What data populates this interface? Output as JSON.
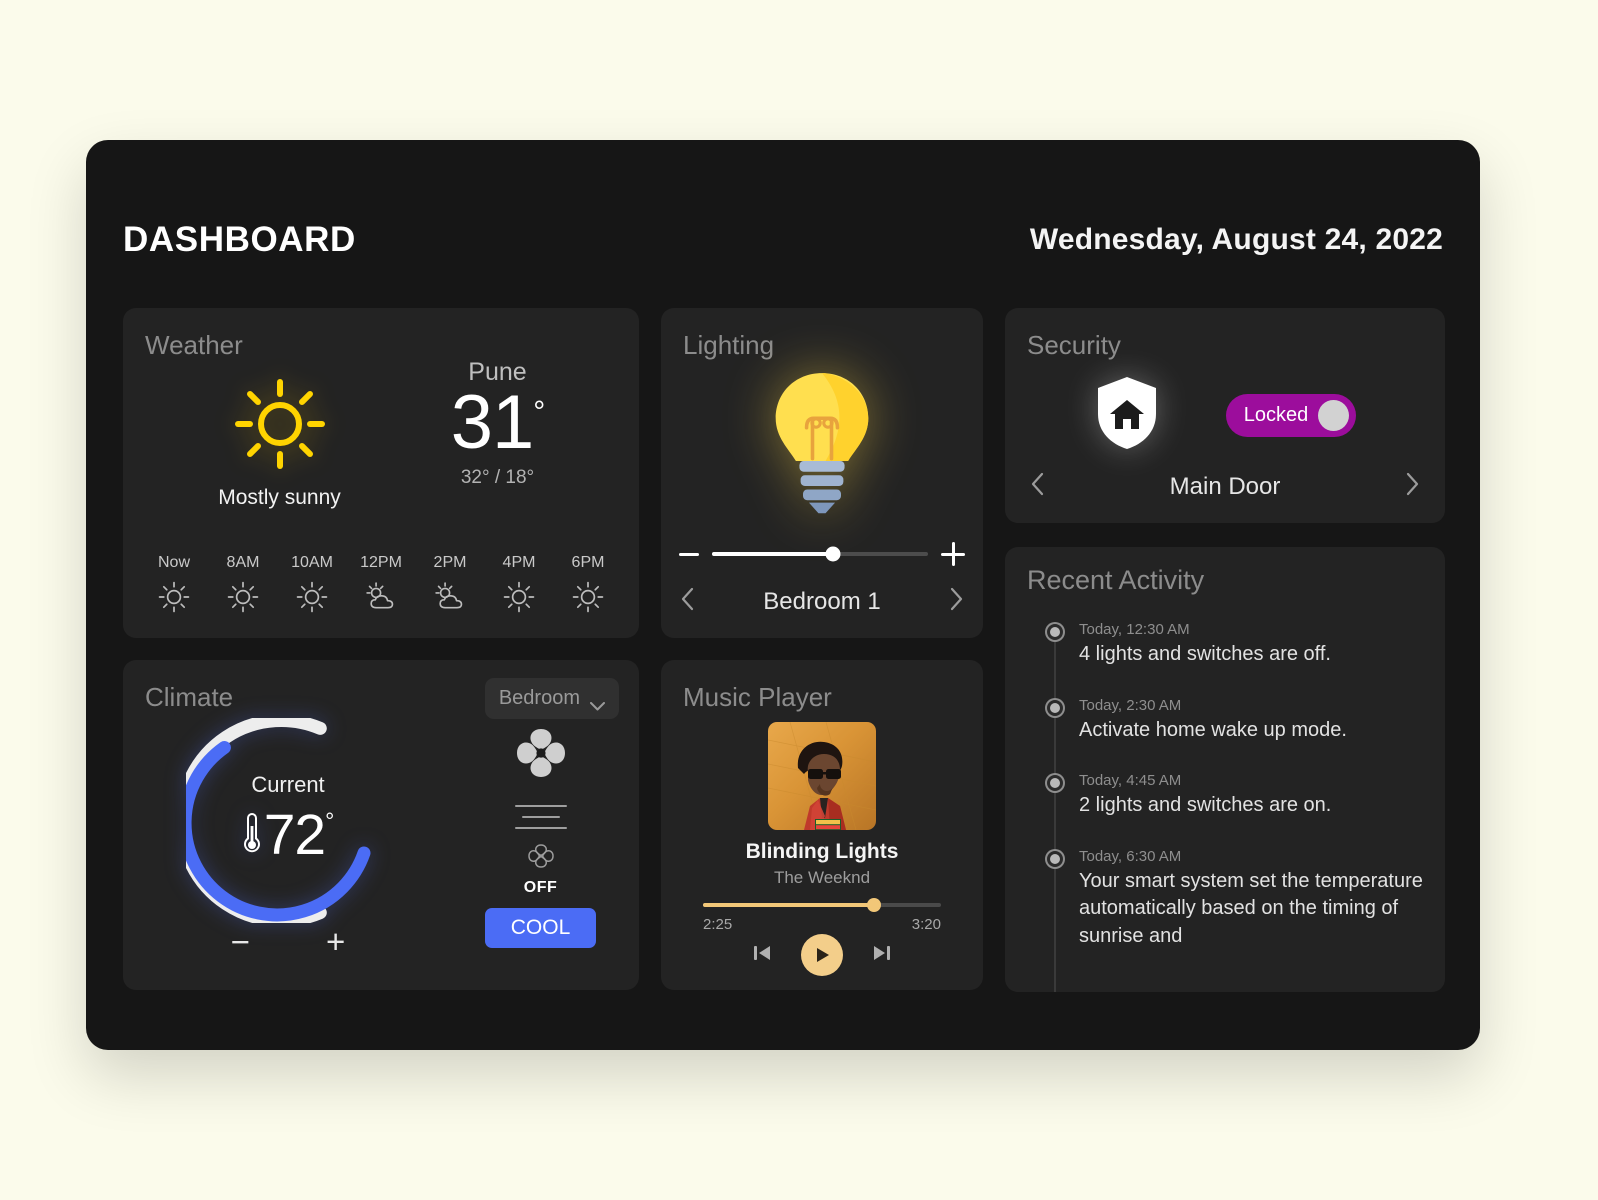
{
  "header": {
    "title": "DASHBOARD",
    "date": "Wednesday, August 24, 2022"
  },
  "weather": {
    "card_title": "Weather",
    "icon": "sun-icon",
    "condition": "Mostly sunny",
    "city": "Pune",
    "temperature": "31",
    "degree": "°",
    "range": "32° / 18°",
    "hourly": [
      {
        "label": "Now",
        "icon": "sun-icon"
      },
      {
        "label": "8AM",
        "icon": "sun-icon"
      },
      {
        "label": "10AM",
        "icon": "sun-icon"
      },
      {
        "label": "12PM",
        "icon": "sun-cloud-icon"
      },
      {
        "label": "2PM",
        "icon": "sun-cloud-icon"
      },
      {
        "label": "4PM",
        "icon": "sun-icon"
      },
      {
        "label": "6PM",
        "icon": "sun-icon"
      }
    ]
  },
  "climate": {
    "card_title": "Climate",
    "room": "Bedroom",
    "gauge_label": "Current",
    "gauge_value": "72",
    "gauge_degree": "°",
    "gauge_percent": 62,
    "minus": "−",
    "plus": "+",
    "fan_state": "OFF",
    "mode_button": "COOL",
    "accent_color": "#4B6CF5"
  },
  "lighting": {
    "card_title": "Lighting",
    "icon": "light-bulb-icon",
    "brightness_percent": 56,
    "room": "Bedroom 1"
  },
  "music": {
    "card_title": "Music Player",
    "album_art": "album-cover-blinding-lights",
    "song": "Blinding Lights",
    "artist": "The Weeknd",
    "elapsed": "2:25",
    "duration": "3:20",
    "progress_percent": 72,
    "accent_color": "#F2C778",
    "prev_icon": "skip-previous-icon",
    "play_icon": "play-icon",
    "next_icon": "skip-next-icon"
  },
  "security": {
    "card_title": "Security",
    "icon": "shield-home-icon",
    "lock_state": "Locked",
    "lock_color": "#9C0D9C",
    "door": "Main Door"
  },
  "activity": {
    "card_title": "Recent Activity",
    "items": [
      {
        "time": "Today, 12:30 AM",
        "text": "4 lights and switches are off."
      },
      {
        "time": "Today, 2:30 AM",
        "text": "Activate home wake up mode."
      },
      {
        "time": "Today, 4:45 AM",
        "text": "2 lights and switches are on."
      },
      {
        "time": "Today, 6:30 AM",
        "text": "Your smart system set the temperature automatically based on the timing of sunrise and"
      }
    ]
  }
}
